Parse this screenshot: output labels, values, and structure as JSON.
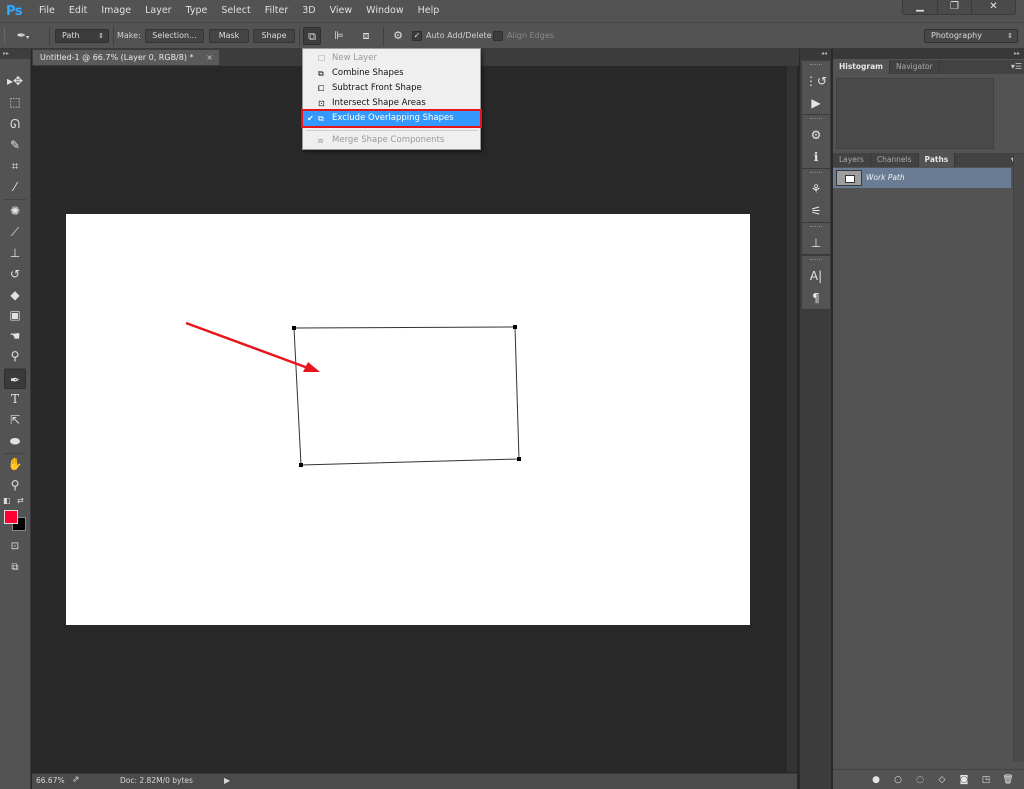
{
  "app": {
    "logo": "Ps",
    "menu": [
      "File",
      "Edit",
      "Image",
      "Layer",
      "Type",
      "Select",
      "Filter",
      "3D",
      "View",
      "Window",
      "Help"
    ],
    "window_controls": {
      "minimize": "▁",
      "restore": "❐",
      "close": "✕"
    }
  },
  "options_bar": {
    "tool_icon": "pen-icon",
    "mode_select": "Path",
    "make_label": "Make:",
    "selection_btn": "Selection...",
    "mask_btn": "Mask",
    "shape_btn": "Shape",
    "auto_add_delete_label": "Auto Add/Delete",
    "auto_add_delete_checked": true,
    "align_edges_label": "Align Edges",
    "align_edges_checked": false,
    "workspace": "Photography"
  },
  "path_operations_menu": {
    "items": [
      {
        "label": "New Layer",
        "icon": "new-layer-icon",
        "disabled": true,
        "checked": false
      },
      {
        "label": "Combine Shapes",
        "icon": "combine-shapes-icon",
        "disabled": false,
        "checked": false
      },
      {
        "label": "Subtract Front Shape",
        "icon": "subtract-front-shape-icon",
        "disabled": false,
        "checked": false
      },
      {
        "label": "Intersect Shape Areas",
        "icon": "intersect-shape-areas-icon",
        "disabled": false,
        "checked": false
      },
      {
        "label": "Exclude Overlapping Shapes",
        "icon": "exclude-overlapping-shapes-icon",
        "disabled": false,
        "checked": true
      },
      {
        "label": "Merge Shape Components",
        "icon": "merge-shape-components-icon",
        "disabled": true,
        "checked": false
      }
    ],
    "highlight_color": "#e8141b"
  },
  "document": {
    "tab_title": "Untitled-1 @ 66.7% (Layer 0, RGB/8) *",
    "close": "×"
  },
  "status_bar": {
    "zoom": "66.67%",
    "doc_info": "Doc: 2.82M/0 bytes"
  },
  "toolbar": {
    "tools": [
      "move-tool",
      "rectangular-marquee-tool",
      "lasso-tool",
      "quick-selection-tool",
      "crop-tool",
      "eyedropper-tool",
      "spot-healing-brush-tool",
      "brush-tool",
      "clone-stamp-tool",
      "history-brush-tool",
      "eraser-tool",
      "gradient-tool",
      "blur-tool",
      "dodge-tool",
      "pen-tool",
      "type-tool",
      "path-selection-tool",
      "ellipse-tool",
      "hand-tool",
      "zoom-tool"
    ],
    "active_tool": "pen-tool",
    "foreground_color": "#ff0033",
    "background_color": "#000000"
  },
  "panels": {
    "top_tabs": [
      "Histogram",
      "Navigator"
    ],
    "top_active": "Histogram",
    "bottom_tabs": [
      "Layers",
      "Channels",
      "Paths"
    ],
    "bottom_active": "Paths",
    "paths": [
      {
        "name": "Work Path",
        "selected": true
      }
    ],
    "footer_icons": [
      "fill-path-icon",
      "stroke-path-icon",
      "load-as-selection-icon",
      "make-work-path-icon",
      "add-mask-icon",
      "new-path-icon",
      "delete-path-icon"
    ]
  },
  "canvas_annotation": {
    "arrow_color": "#e8141b"
  }
}
